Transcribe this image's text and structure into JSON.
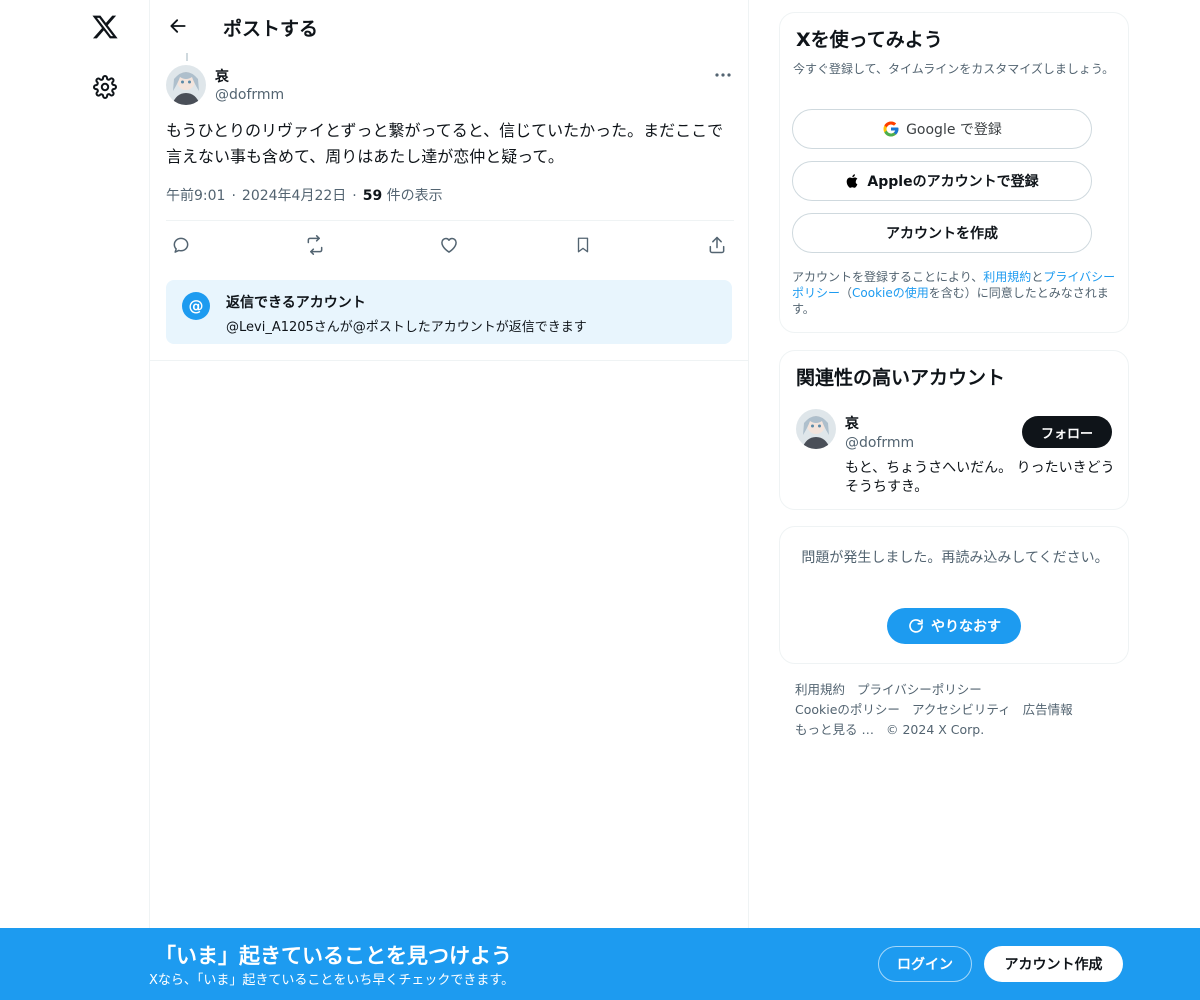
{
  "nav": {
    "logo_icon": "x-logo-icon",
    "settings_icon": "gear-icon"
  },
  "header": {
    "back_icon": "arrow-left-icon",
    "title": "ポストする"
  },
  "post": {
    "author_name": "哀",
    "author_handle": "@dofrmm",
    "text": "もうひとりのリヴァイとずっと繋がってると、信じていたかった。まだここで言えない事も含めて、周りはあたし達が恋仲と疑って。",
    "time": "午前9:01",
    "date": "2024年4月22日",
    "views_count": "59",
    "views_label": " 件の表示",
    "actions": [
      "reply-icon",
      "retweet-icon",
      "like-icon",
      "bookmark-icon",
      "share-icon"
    ]
  },
  "reply_restriction": {
    "icon": "@",
    "title": "返信できるアカウント",
    "description": "@Levi_A1205さんが@ポストしたアカウントが返信できます"
  },
  "signup": {
    "title": "Xを使ってみよう",
    "subtitle": "今すぐ登録して、タイムラインをカスタマイズしましょう。",
    "google_label": "Google で登録",
    "apple_label": "Appleのアカウントで登録",
    "create_label": "アカウントを作成",
    "terms_pre": "アカウントを登録することにより、",
    "terms_link1": "利用規約",
    "terms_and": "と",
    "terms_link2": "プライバシーポリシー",
    "terms_paren_open": "（",
    "terms_link3": "Cookieの使用",
    "terms_post": "を含む）に同意したとみなされます。"
  },
  "related": {
    "title": "関連性の高いアカウント",
    "name": "哀",
    "handle": "@dofrmm",
    "follow_label": "フォロー",
    "bio": "もと、ちょうさへいだん。 りったいきどうそうちすき。"
  },
  "error": {
    "message": "問題が発生しました。再読み込みしてください。",
    "retry_label": "やりなおす"
  },
  "footer": {
    "links": [
      "利用規約",
      "プライバシーポリシー",
      "Cookieのポリシー",
      "アクセシビリティ",
      "広告情報",
      "もっと見る …"
    ],
    "copyright": "© 2024 X Corp."
  },
  "bottom_bar": {
    "title": "「いま」起きていることを見つけよう",
    "subtitle": "Xなら、「いま」起きていることをいち早くチェックできます。",
    "login_label": "ログイン",
    "signup_label": "アカウント作成"
  },
  "colors": {
    "accent": "#1d9bf0",
    "text": "#0f1419",
    "secondary": "#536471",
    "border": "#eff3f4",
    "reply_bg": "#e8f5fd"
  }
}
